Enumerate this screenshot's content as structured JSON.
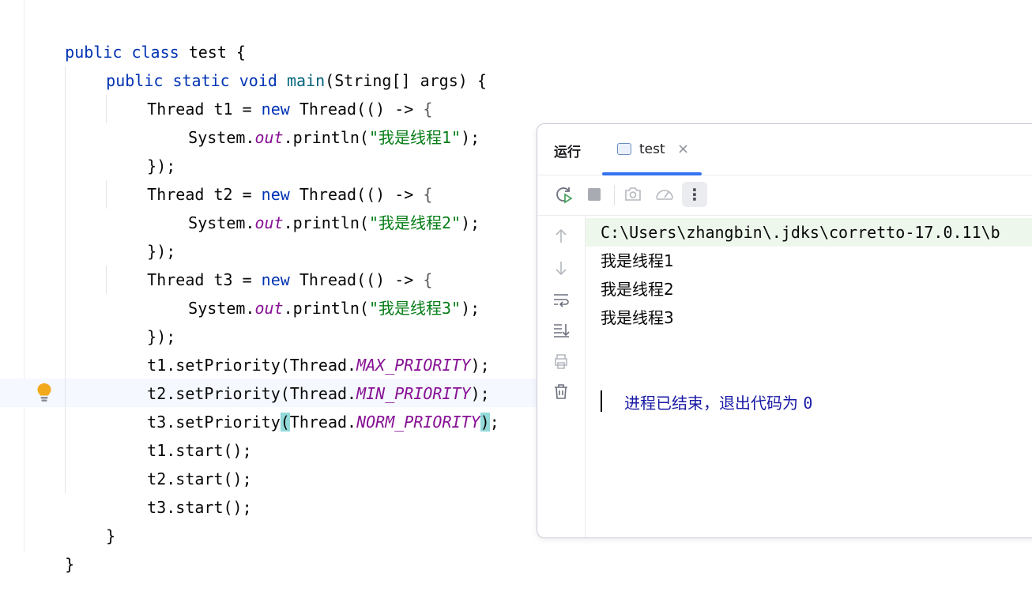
{
  "editor": {
    "lines": [
      {
        "t1": "public",
        "t2": " ",
        "t3": "class",
        "t4": " test {"
      },
      {
        "t1": "public",
        "t2": " ",
        "t3": "static",
        "t4": " ",
        "t5": "void",
        "t6": " ",
        "t7": "main",
        "t8": "(String[] args) {"
      },
      {
        "t1": "Thread t1 = ",
        "t2": "new",
        "t3": " Thread(() -> ",
        "t4": "{"
      },
      {
        "t1": "System.",
        "t2": "out",
        "t3": ".println(",
        "t4": "\"我是线程1\"",
        "t5": ");"
      },
      {
        "t1": "});"
      },
      {
        "t1": "Thread t2 = ",
        "t2": "new",
        "t3": " Thread(() -> ",
        "t4": "{"
      },
      {
        "t1": "System.",
        "t2": "out",
        "t3": ".println(",
        "t4": "\"我是线程2\"",
        "t5": ");"
      },
      {
        "t1": "});"
      },
      {
        "t1": "Thread t3 = ",
        "t2": "new",
        "t3": " Thread(() -> ",
        "t4": "{"
      },
      {
        "t1": "System.",
        "t2": "out",
        "t3": ".println(",
        "t4": "\"我是线程3\"",
        "t5": ");"
      },
      {
        "t1": "});"
      },
      {
        "t1": "t1.setPriority(Thread.",
        "t2": "MAX_PRIORITY",
        "t3": ");"
      },
      {
        "t1": "t2.setPriority(Thread.",
        "t2": "MIN_PRIORITY",
        "t3": ");"
      },
      {
        "t1": "t3.setPriority",
        "t2": "(",
        "t3": "Thread.",
        "t4": "NORM_PRIORITY",
        "t5": ")",
        "t6": ";"
      },
      {
        "t1": "t1.start();"
      },
      {
        "t1": "t2.start();"
      },
      {
        "t1": "t3.start();"
      },
      {
        "t1": "}"
      },
      {
        "t1": "}"
      }
    ],
    "intention_icon": "lightbulb-icon"
  },
  "run_panel": {
    "title": "运行",
    "tab_label": "test",
    "tab_close": "×",
    "toolbar_icons": [
      "rerun-icon",
      "stop-icon",
      "camera-icon",
      "gauge-icon",
      "more-icon"
    ],
    "more_glyph": "⋮",
    "sidebar_icons": [
      "arrow-up-icon",
      "arrow-down-icon",
      "soft-wrap-icon",
      "scroll-to-end-icon",
      "print-icon",
      "trash-icon"
    ],
    "console": {
      "command": "C:\\Users\\zhangbin\\.jdks\\corretto-17.0.11\\b",
      "output": [
        "我是线程1",
        "我是线程2",
        "我是线程3"
      ],
      "exit_text": "进程已结束，退出代码为 ",
      "exit_code": "0"
    }
  },
  "colors": {
    "keyword": "#0033b3",
    "string": "#067d17",
    "static_field": "#871094",
    "method": "#00627a",
    "tab_underline": "#3574f0",
    "command_bg": "#edf7ec",
    "exit_text": "#1a1aa6"
  }
}
